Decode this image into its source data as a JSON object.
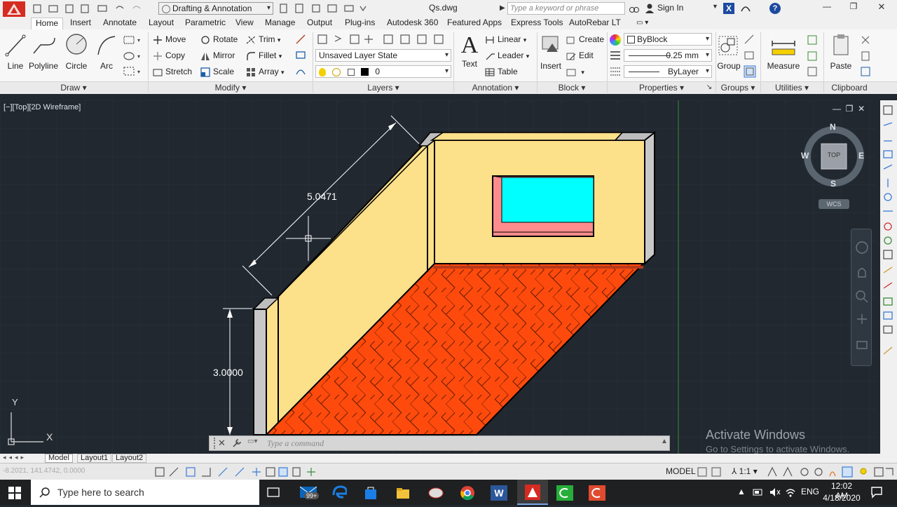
{
  "titlebar": {
    "workspace": "Drafting & Annotation",
    "filename": "Qs.dwg",
    "search_placeholder": "Type a keyword or phrase",
    "signin": "Sign In"
  },
  "tabs": [
    "Home",
    "Insert",
    "Annotate",
    "Layout",
    "Parametric",
    "View",
    "Manage",
    "Output",
    "Plug-ins",
    "Autodesk 360",
    "Featured Apps",
    "Express Tools",
    "AutoRebar LT"
  ],
  "ribbon": {
    "draw": {
      "line": "Line",
      "polyline": "Polyline",
      "circle": "Circle",
      "arc": "Arc",
      "panel": "Draw"
    },
    "modify": {
      "move": "Move",
      "rotate": "Rotate",
      "trim": "Trim",
      "copy": "Copy",
      "mirror": "Mirror",
      "fillet": "Fillet",
      "stretch": "Stretch",
      "scale": "Scale",
      "array": "Array",
      "panel": "Modify"
    },
    "layers": {
      "layer_state": "Unsaved Layer State",
      "current_layer": "0",
      "panel": "Layers"
    },
    "annotation": {
      "text": "Text",
      "linear": "Linear",
      "leader": "Leader",
      "table": "Table",
      "panel": "Annotation"
    },
    "block": {
      "insert": "Insert",
      "create": "Create",
      "edit": "Edit",
      "panel": "Block"
    },
    "properties": {
      "color": "ByBlock",
      "lineweight": "0.25 mm",
      "linetype": "ByLayer",
      "panel": "Properties"
    },
    "groups": {
      "group": "Group",
      "panel": "Groups"
    },
    "utilities": {
      "measure": "Measure",
      "panel": "Utilities"
    },
    "clipboard": {
      "paste": "Paste",
      "panel": "Clipboard"
    }
  },
  "viewport": {
    "label": "[−][Top][2D Wireframe]",
    "dim_aligned": "5.0471",
    "dim_vertical": "3.0000",
    "compass": {
      "n": "N",
      "s": "S",
      "e": "E",
      "w": "W",
      "top": "TOP",
      "wcs": "WCS"
    },
    "ucs_x": "X",
    "ucs_y": "Y",
    "watermark_title": "Activate Windows",
    "watermark_sub": "Go to Settings to activate Windows."
  },
  "command": {
    "placeholder": "Type a command"
  },
  "layout_tabs": [
    "Model",
    "Layout1",
    "Layout2"
  ],
  "status": {
    "coords": "-8.2021, 141.4742, 0.0000",
    "model": "MODEL",
    "scale": "1:1"
  },
  "taskbar": {
    "search": "Type here to search",
    "badge": "99+",
    "lang": "ENG",
    "time": "12:02 AM",
    "date": "4/18/2020"
  },
  "colors": {
    "wall": "#fde08a",
    "floor": "#ff4a0d",
    "window": "#00ffff",
    "sill": "#ff8c8c",
    "wall_edge": "#c8c8c8"
  }
}
